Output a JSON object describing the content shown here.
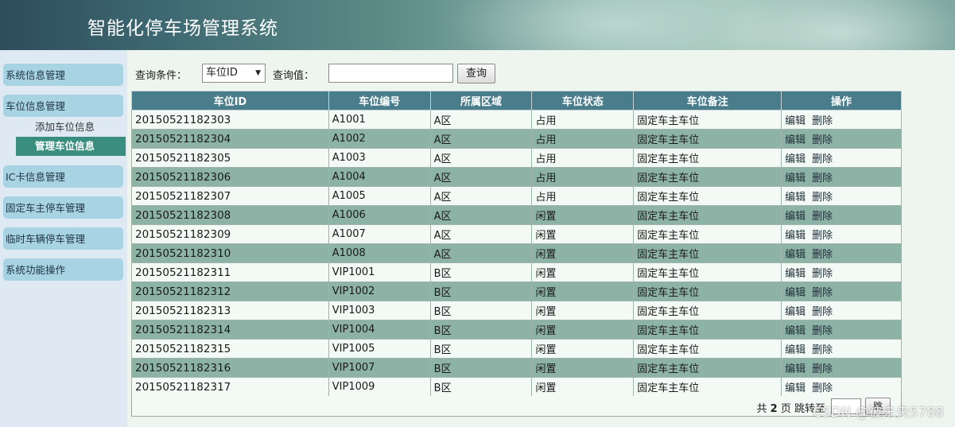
{
  "header": {
    "title": "智能化停车场管理系统"
  },
  "sidebar": {
    "groups": [
      {
        "label": "系统信息管理"
      },
      {
        "label": "车位信息管理",
        "children": [
          {
            "label": "添加车位信息"
          },
          {
            "label": "管理车位信息",
            "active": true
          }
        ]
      },
      {
        "label": "IC卡信息管理"
      },
      {
        "label": "固定车主停车管理"
      },
      {
        "label": "临时车辆停车管理"
      },
      {
        "label": "系统功能操作"
      }
    ]
  },
  "search": {
    "condition_label": "查询条件：",
    "condition_selected": "车位ID",
    "value_label": "查询值：",
    "value": "",
    "button_label": "查询"
  },
  "table": {
    "columns": [
      "车位ID",
      "车位编号",
      "所属区域",
      "车位状态",
      "车位备注",
      "操作"
    ],
    "edit_label": "编辑",
    "delete_label": "删除",
    "rows": [
      [
        "20150521182303",
        "A1001",
        "A区",
        "占用",
        "固定车主车位"
      ],
      [
        "20150521182304",
        "A1002",
        "A区",
        "占用",
        "固定车主车位"
      ],
      [
        "20150521182305",
        "A1003",
        "A区",
        "占用",
        "固定车主车位"
      ],
      [
        "20150521182306",
        "A1004",
        "A区",
        "占用",
        "固定车主车位"
      ],
      [
        "20150521182307",
        "A1005",
        "A区",
        "占用",
        "固定车主车位"
      ],
      [
        "20150521182308",
        "A1006",
        "A区",
        "闲置",
        "固定车主车位"
      ],
      [
        "20150521182309",
        "A1007",
        "A区",
        "闲置",
        "固定车主车位"
      ],
      [
        "20150521182310",
        "A1008",
        "A区",
        "闲置",
        "固定车主车位"
      ],
      [
        "20150521182311",
        "VIP1001",
        "B区",
        "闲置",
        "固定车主车位"
      ],
      [
        "20150521182312",
        "VIP1002",
        "B区",
        "闲置",
        "固定车主车位"
      ],
      [
        "20150521182313",
        "VIP1003",
        "B区",
        "闲置",
        "固定车主车位"
      ],
      [
        "20150521182314",
        "VIP1004",
        "B区",
        "闲置",
        "固定车主车位"
      ],
      [
        "20150521182315",
        "VIP1005",
        "B区",
        "闲置",
        "固定车主车位"
      ],
      [
        "20150521182316",
        "VIP1007",
        "B区",
        "闲置",
        "固定车主车位"
      ],
      [
        "20150521182317",
        "VIP1009",
        "B区",
        "闲置",
        "固定车主车位"
      ]
    ]
  },
  "pager": {
    "prefix": "共",
    "total_pages": "2",
    "suffix": "页 跳转至",
    "jump_value": "",
    "go_label": "跳"
  },
  "watermark": "CSDN @彼未央5788",
  "colors": {
    "header_text": "#ffffff",
    "table_header_bg": "#4a7d8c",
    "row_even_bg": "#8db3a7",
    "row_odd_bg": "#f3f9f4",
    "menu_bg": "#a7d3e3",
    "active_item_bg": "#3a8e7f"
  }
}
